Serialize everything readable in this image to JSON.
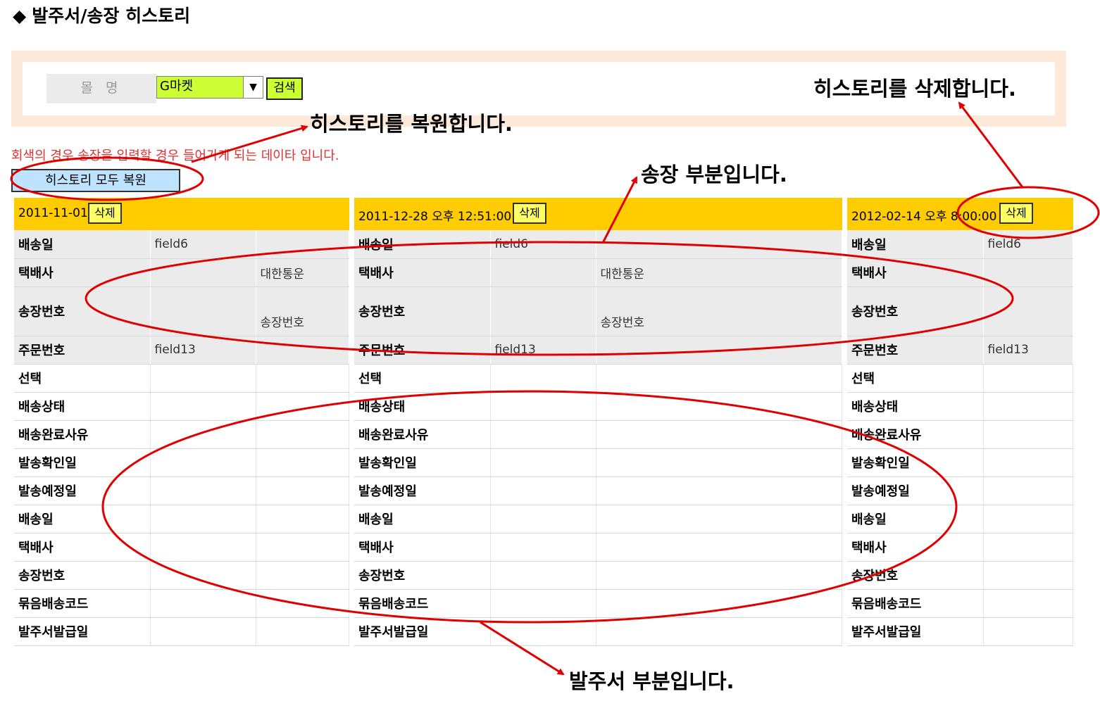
{
  "page": {
    "title": "발주서/송장 히스토리",
    "title_icon": "diamond-icon",
    "notice": "회색의 경우 송장을 입력할 경우 들어가게 되는 데이타 입니다.",
    "restore_all_label": "히스토리 모두 복원"
  },
  "search": {
    "mall_label": "몰 명",
    "mall_value": "G마켓",
    "search_label": "검색"
  },
  "history": [
    {
      "date": "2011-11-01",
      "delete_label": "삭제",
      "ship_date": {
        "key": "배송일",
        "value": "field6",
        "extra": ""
      },
      "courier": {
        "key": "택배사",
        "value": "",
        "extra": "대한통운"
      },
      "invoice_no": {
        "key": "송장번호",
        "value": "",
        "extra": "송장번호"
      },
      "order_no": {
        "key": "주문번호",
        "value": "field13",
        "extra": ""
      },
      "order_rows": [
        "선택",
        "배송상태",
        "배송완료사유",
        "발송확인일",
        "발송예정일",
        "배송일",
        "택배사",
        "송장번호",
        "묶음배송코드",
        "발주서발급일"
      ]
    },
    {
      "date": "2011-12-28 오후 12:51:00",
      "delete_label": "삭제",
      "ship_date": {
        "key": "배송일",
        "value": "field6",
        "extra": ""
      },
      "courier": {
        "key": "택배사",
        "value": "",
        "extra": "대한통운"
      },
      "invoice_no": {
        "key": "송장번호",
        "value": "",
        "extra": "송장번호"
      },
      "order_no": {
        "key": "주문번호",
        "value": "field13",
        "extra": ""
      },
      "order_rows": [
        "선택",
        "배송상태",
        "배송완료사유",
        "발송확인일",
        "발송예정일",
        "배송일",
        "택배사",
        "송장번호",
        "묶음배송코드",
        "발주서발급일"
      ]
    },
    {
      "date": "2012-02-14 오후 8:00:00",
      "delete_label": "삭제",
      "ship_date": {
        "key": "배송일",
        "value": "field6",
        "extra": ""
      },
      "courier": {
        "key": "택배사",
        "value": "",
        "extra": ""
      },
      "invoice_no": {
        "key": "송장번호",
        "value": "",
        "extra": ""
      },
      "order_no": {
        "key": "주문번호",
        "value": "field13",
        "extra": ""
      },
      "order_rows": [
        "선택",
        "배송상태",
        "배송완료사유",
        "발송확인일",
        "발송예정일",
        "배송일",
        "택배사",
        "송장번호",
        "묶음배송코드",
        "발주서발급일"
      ]
    }
  ],
  "annotations": {
    "restore": "히스토리를 복원합니다.",
    "delete": "히스토리를 삭제합니다.",
    "invoice_part": "송장 부분입니다.",
    "order_part": "발주서 부분입니다.",
    "annotation_color": "#e00000"
  }
}
